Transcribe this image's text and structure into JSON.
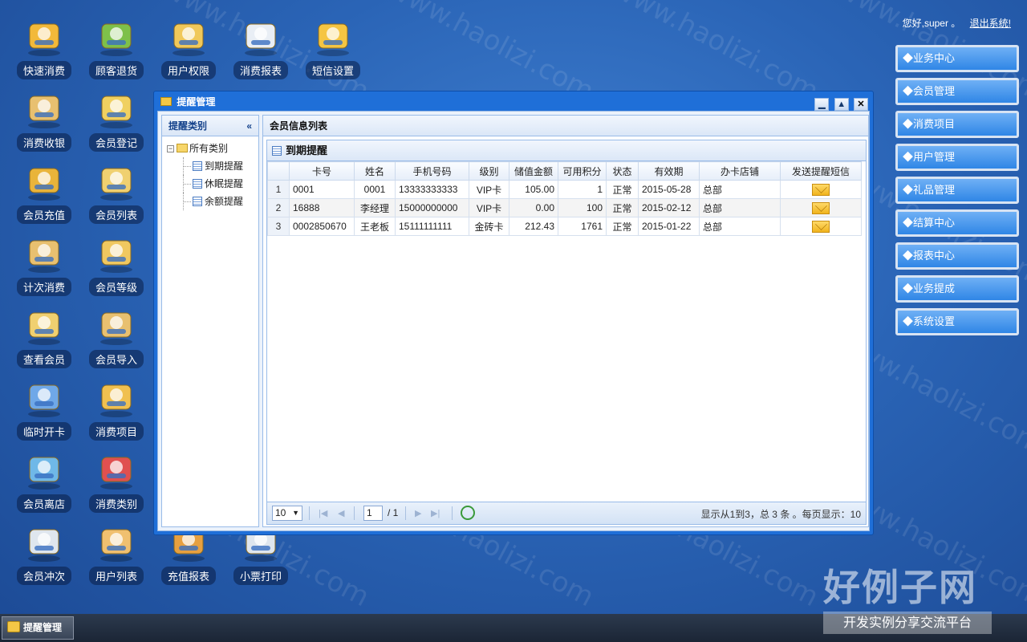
{
  "desktop_icons": [
    {
      "label": "快速消费",
      "icon": "card-payment-icon"
    },
    {
      "label": "顾客退货",
      "icon": "return-arrow-icon"
    },
    {
      "label": "用户权限",
      "icon": "user-lock-icon"
    },
    {
      "label": "消费报表",
      "icon": "bar-report-icon"
    },
    {
      "label": "短信设置",
      "icon": "sms-envelope-gear-icon"
    },
    {
      "label": "消费收银",
      "icon": "cash-register-icon"
    },
    {
      "label": "会员登记",
      "icon": "member-register-icon"
    },
    {
      "label": "会员充值",
      "icon": "coins-icon"
    },
    {
      "label": "会员列表",
      "icon": "member-list-icon"
    },
    {
      "label": "计次消费",
      "icon": "count-consume-icon"
    },
    {
      "label": "会员等级",
      "icon": "member-level-icon"
    },
    {
      "label": "查看会员",
      "icon": "view-member-icon"
    },
    {
      "label": "会员导入",
      "icon": "member-import-icon"
    },
    {
      "label": "临时开卡",
      "icon": "temp-card-icon"
    },
    {
      "label": "消费项目",
      "icon": "basket-icon"
    },
    {
      "label": "会员离店",
      "icon": "member-leave-icon"
    },
    {
      "label": "消费类别",
      "icon": "category-tree-icon"
    },
    {
      "label": "会员冲次",
      "icon": "calculator-icon"
    },
    {
      "label": "用户列表",
      "icon": "user-list-icon"
    },
    {
      "label": "充值报表",
      "icon": "recharge-report-icon"
    },
    {
      "label": "小票打印",
      "icon": "printer-icon"
    }
  ],
  "header": {
    "greeting": "您好,super 。",
    "logout": "退出系统!"
  },
  "right_menu": [
    "◆业务中心",
    "◆会员管理",
    "◆消费项目",
    "◆用户管理",
    "◆礼品管理",
    "◆结算中心",
    "◆报表中心",
    "◆业务提成",
    "◆系统设置"
  ],
  "window": {
    "title": "提醒管理",
    "buttons": {
      "min": "▁",
      "max": "▲",
      "close": "✕"
    },
    "left_panel": {
      "title": "提醒类别",
      "collapse": "«",
      "root": "所有类别",
      "items": [
        "到期提醒",
        "休眠提醒",
        "余额提醒"
      ]
    },
    "right_panel": {
      "title": "会员信息列表",
      "grid_title": "到期提醒",
      "columns": [
        "卡号",
        "姓名",
        "手机号码",
        "级别",
        "储值金额",
        "可用积分",
        "状态",
        "有效期",
        "办卡店铺",
        "发送提醒短信"
      ],
      "rows": [
        {
          "n": "1",
          "card": "0001",
          "name": "0001",
          "phone": "13333333333",
          "level": "VIP卡",
          "balance": "105.00",
          "points": "1",
          "status": "正常",
          "expiry": "2015-05-28",
          "store": "总部"
        },
        {
          "n": "2",
          "card": "16888",
          "name": "李经理",
          "phone": "15000000000",
          "level": "VIP卡",
          "balance": "0.00",
          "points": "100",
          "status": "正常",
          "expiry": "2015-02-12",
          "store": "总部"
        },
        {
          "n": "3",
          "card": "0002850670",
          "name": "王老板",
          "phone": "15111111111",
          "level": "金砖卡",
          "balance": "212.43",
          "points": "1761",
          "status": "正常",
          "expiry": "2015-01-22",
          "store": "总部"
        }
      ],
      "pager": {
        "page_size": "10",
        "page": "1",
        "of_total": "/ 1",
        "info": "显示从1到3，总 3 条 。每页显示：10"
      }
    }
  },
  "taskbar": {
    "item": "提醒管理"
  },
  "watermark": {
    "text": "www.haolizi.com",
    "logo_big": "好例子网",
    "logo_small": "开发实例分享交流平台"
  }
}
